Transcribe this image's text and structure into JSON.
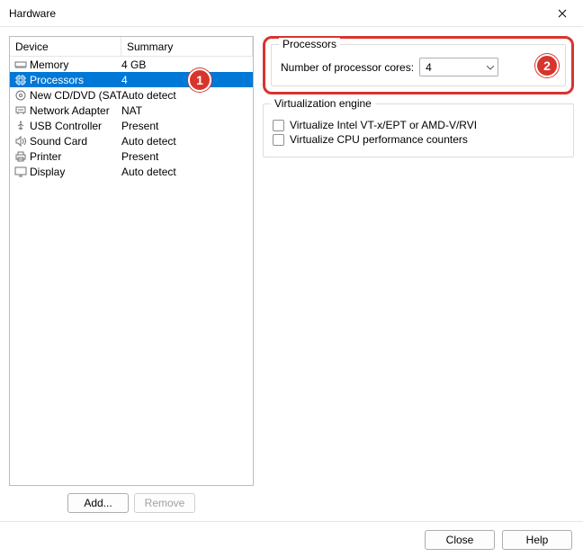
{
  "window": {
    "title": "Hardware"
  },
  "list": {
    "header": {
      "device": "Device",
      "summary": "Summary"
    },
    "rows": [
      {
        "icon": "memory",
        "device": "Memory",
        "summary": "4 GB",
        "selected": false
      },
      {
        "icon": "cpu",
        "device": "Processors",
        "summary": "4",
        "selected": true
      },
      {
        "icon": "disc",
        "device": "New CD/DVD (SATA)",
        "summary": "Auto detect",
        "selected": false
      },
      {
        "icon": "network",
        "device": "Network Adapter",
        "summary": "NAT",
        "selected": false
      },
      {
        "icon": "usb",
        "device": "USB Controller",
        "summary": "Present",
        "selected": false
      },
      {
        "icon": "sound",
        "device": "Sound Card",
        "summary": "Auto detect",
        "selected": false
      },
      {
        "icon": "printer",
        "device": "Printer",
        "summary": "Present",
        "selected": false
      },
      {
        "icon": "display",
        "device": "Display",
        "summary": "Auto detect",
        "selected": false
      }
    ]
  },
  "buttons": {
    "add": "Add...",
    "remove": "Remove",
    "close": "Close",
    "help": "Help"
  },
  "processors_group": {
    "legend": "Processors",
    "label": "Number of processor cores:",
    "value": "4"
  },
  "virtualization_group": {
    "legend": "Virtualization engine",
    "opt1": "Virtualize Intel VT-x/EPT or AMD-V/RVI",
    "opt2": "Virtualize CPU performance counters"
  },
  "annotations": {
    "badge1": "1",
    "badge2": "2"
  }
}
